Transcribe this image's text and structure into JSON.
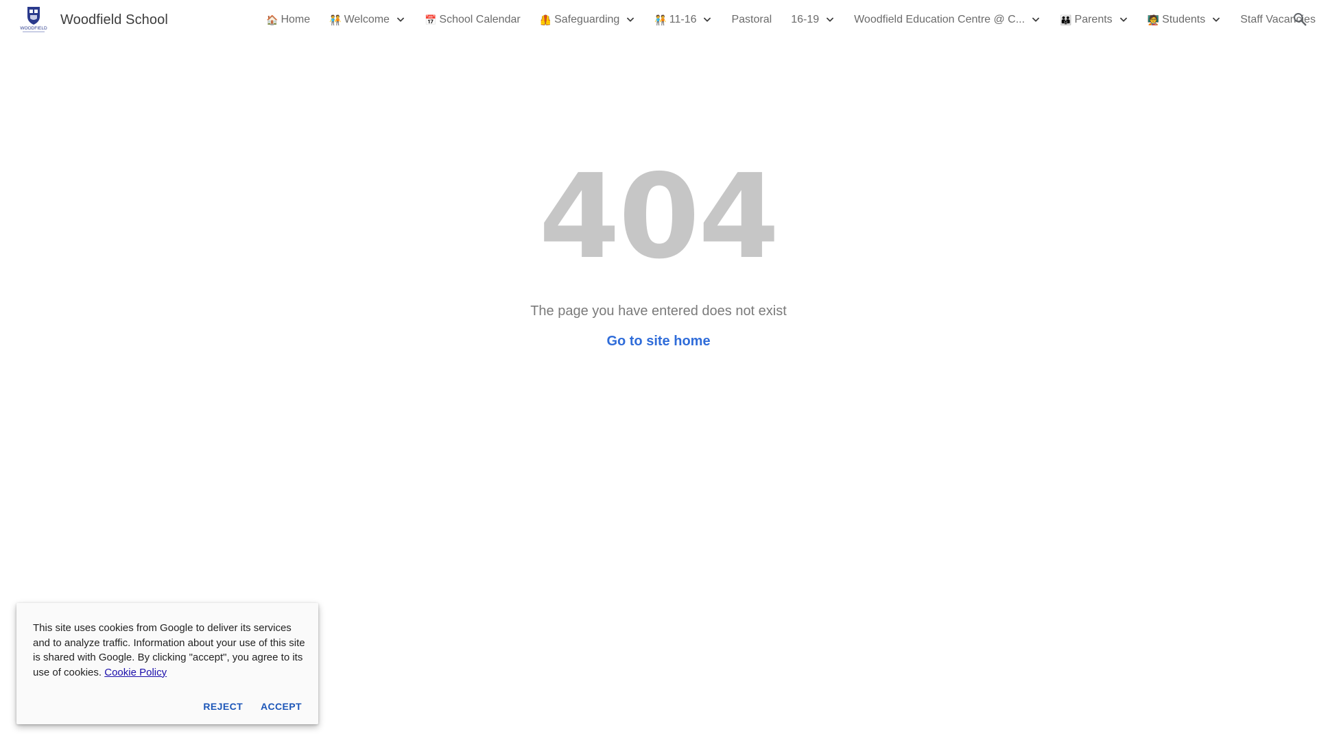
{
  "header": {
    "site_title": "Woodfield School",
    "logo_text": "WOODFIELD",
    "logo_icon": "school-crest-logo",
    "search_icon": "search-icon"
  },
  "nav": [
    {
      "id": "home",
      "emoji": "🏠",
      "label": "Home",
      "dropdown": false
    },
    {
      "id": "welcome",
      "emoji": "🧑‍🤝‍🧑",
      "label": "Welcome",
      "dropdown": true
    },
    {
      "id": "school-calendar",
      "emoji": "📅",
      "label": "School Calendar",
      "dropdown": false
    },
    {
      "id": "safeguarding",
      "emoji": "🦺",
      "label": "Safeguarding",
      "dropdown": true
    },
    {
      "id": "11-16",
      "emoji": "🧑‍🤝‍🧑",
      "label": "11-16",
      "dropdown": true
    },
    {
      "id": "pastoral",
      "emoji": "",
      "label": "Pastoral",
      "dropdown": false
    },
    {
      "id": "16-19",
      "emoji": "",
      "label": "16-19",
      "dropdown": true
    },
    {
      "id": "woodfield-education-centre",
      "emoji": "",
      "label": "Woodfield Education Centre @ C...",
      "dropdown": true
    },
    {
      "id": "parents",
      "emoji": "👪",
      "label": "Parents",
      "dropdown": true
    },
    {
      "id": "students",
      "emoji": "🧑‍🏫",
      "label": "Students",
      "dropdown": true
    },
    {
      "id": "staff-vacancies",
      "emoji": "",
      "label": "Staff Vacancies",
      "dropdown": false
    }
  ],
  "error": {
    "code": "404",
    "message": "The page you have entered does not exist",
    "home_link": "Go to site home"
  },
  "cookie_banner": {
    "text": "This site uses cookies from Google to deliver its services and to analyze traffic. Information about your use of this site is shared with Google. By clicking \"accept\", you agree to its use of cookies.",
    "policy_link": "Cookie Policy",
    "reject_label": "REJECT",
    "accept_label": "ACCEPT"
  },
  "colors": {
    "brand_navy": "#2a3a8c",
    "link_blue": "#2f6cd9",
    "error_gray": "#c6c6c6",
    "cookie_button_blue": "#1c56b8"
  }
}
